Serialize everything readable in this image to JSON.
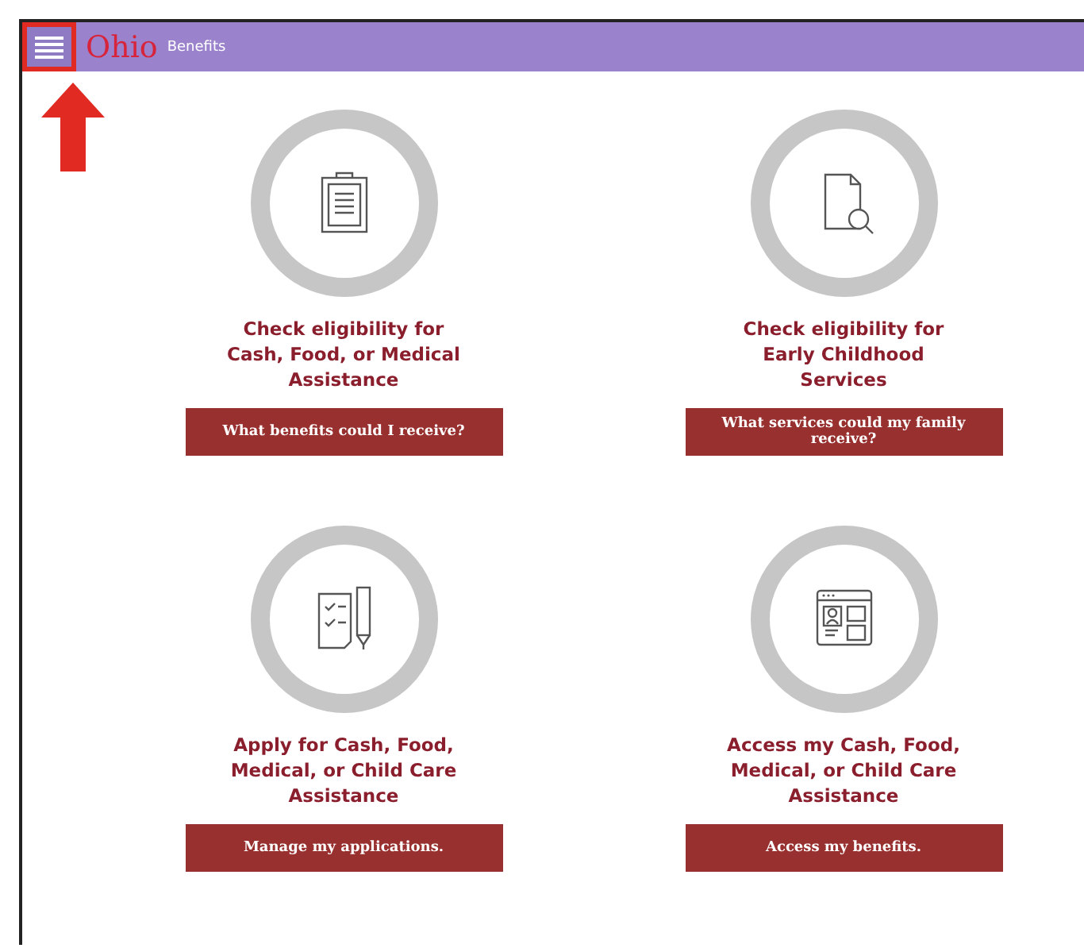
{
  "header": {
    "menu": {
      "highlighted": true
    },
    "logo": "Ohio",
    "subtitle": "Benefits"
  },
  "cards": [
    {
      "title": "Check eligibility for Cash, Food, or Medical Assistance",
      "button": "What benefits could I receive?"
    },
    {
      "title": "Check eligibility for Early Childhood Services",
      "button": "What services could my family receive?"
    },
    {
      "title": "Apply for Cash, Food, Medical, or Child Care Assistance",
      "button": "Manage my applications."
    },
    {
      "title": "Access my Cash, Food, Medical, or Child Care Assistance",
      "button": "Access my benefits."
    }
  ]
}
